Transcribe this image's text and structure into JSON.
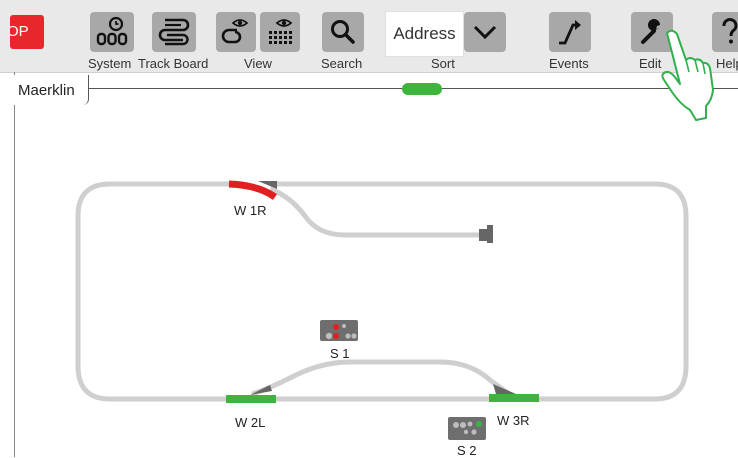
{
  "toolbar": {
    "stop_label": "OP",
    "system_label": "System",
    "track_board_label": "Track Board",
    "view_label": "View",
    "search_label": "Search",
    "sort_value": "Address",
    "sort_label": "Sort",
    "events_label": "Events",
    "edit_label": "Edit",
    "help_label": "Help"
  },
  "layout": {
    "tab_label": "Maerklin",
    "turnouts": [
      {
        "label": "W 1R",
        "state_color": "#e02020"
      },
      {
        "label": "W 2L",
        "state_color": "#3bb53b"
      },
      {
        "label": "W 3R",
        "state_color": "#3bb53b"
      }
    ],
    "signals": [
      {
        "label": "S 1",
        "aspect": "red"
      },
      {
        "label": "S 2",
        "aspect": "green"
      }
    ]
  },
  "colors": {
    "toolbar_bg": "#e9e9e9",
    "button_bg": "#a8a8a8",
    "stop_red": "#e8262b",
    "track_gray": "#cfcfcf",
    "hand_green": "#2fb14b"
  }
}
